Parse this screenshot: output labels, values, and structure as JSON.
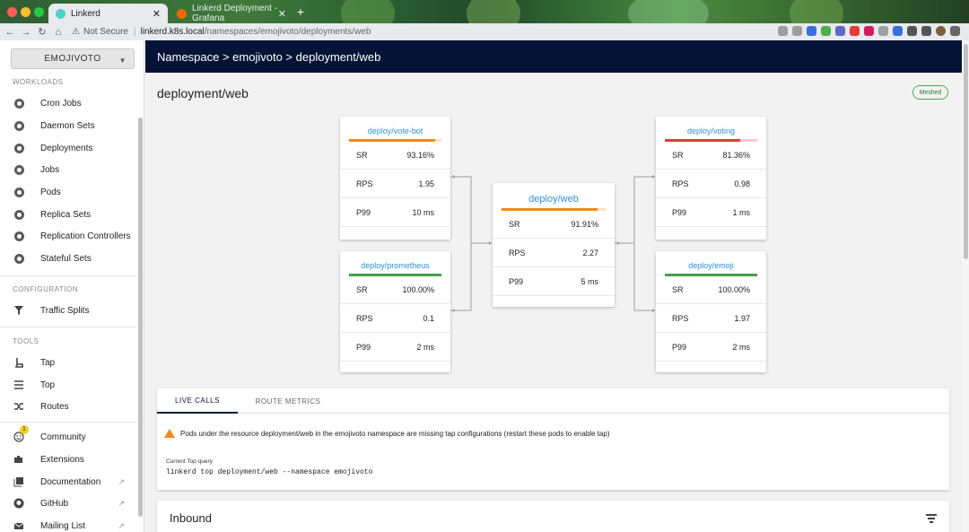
{
  "browser": {
    "tabs": [
      {
        "title": "Linkerd",
        "active": true,
        "favicon_color": "#4fd1c5"
      },
      {
        "title": "Linkerd Deployment - Grafana",
        "active": false,
        "favicon_color": "#f46800"
      }
    ],
    "new_tab": "+",
    "close_glyph": "✕",
    "security": "Not Secure",
    "url_host": "linkerd.k8s.local",
    "url_path": "/namespaces/emojivoto/deployments/web"
  },
  "sidebar": {
    "namespace_select": "EMOJIVOTO",
    "sections": {
      "workloads": "WORKLOADS",
      "configuration": "CONFIGURATION",
      "tools": "TOOLS"
    },
    "workloads": [
      {
        "label": "Cron Jobs",
        "icon": "cron-jobs-icon"
      },
      {
        "label": "Daemon Sets",
        "icon": "daemon-sets-icon"
      },
      {
        "label": "Deployments",
        "icon": "deployments-icon"
      },
      {
        "label": "Jobs",
        "icon": "jobs-icon"
      },
      {
        "label": "Pods",
        "icon": "pods-icon"
      },
      {
        "label": "Replica Sets",
        "icon": "replica-sets-icon"
      },
      {
        "label": "Replication Controllers",
        "icon": "replication-controllers-icon"
      },
      {
        "label": "Stateful Sets",
        "icon": "stateful-sets-icon"
      }
    ],
    "configuration": [
      {
        "label": "Traffic Splits",
        "icon": "filter-icon"
      }
    ],
    "tools": [
      {
        "label": "Tap",
        "icon": "tap-icon"
      },
      {
        "label": "Top",
        "icon": "list-icon"
      },
      {
        "label": "Routes",
        "icon": "shuffle-icon"
      }
    ],
    "community": {
      "label": "Community",
      "badge": "1"
    },
    "links": [
      {
        "label": "Extensions"
      },
      {
        "label": "Documentation"
      },
      {
        "label": "GitHub"
      },
      {
        "label": "Mailing List"
      }
    ]
  },
  "header": {
    "breadcrumb": "Namespace > emojivoto > deployment/web"
  },
  "page": {
    "title": "deployment/web",
    "status_badge": "Meshed"
  },
  "graph": {
    "labels": {
      "sr": "SR",
      "rps": "RPS",
      "p99": "P99"
    },
    "center": {
      "name": "deploy/web",
      "sr": "91.91%",
      "rps": "2.27",
      "p99": "5 ms",
      "success": 0.9191,
      "color": "#ef8a1c"
    },
    "upstream": [
      {
        "name": "deploy/vote-bot",
        "sr": "93.16%",
        "rps": "1.95",
        "p99": "10 ms",
        "success": 0.9316,
        "color": "#ef8a1c"
      },
      {
        "name": "deploy/prometheus",
        "sr": "100.00%",
        "rps": "0.1",
        "p99": "2 ms",
        "success": 1.0,
        "color": "#43a047"
      }
    ],
    "downstream": [
      {
        "name": "deploy/voting",
        "sr": "81.36%",
        "rps": "0.98",
        "p99": "1 ms",
        "success": 0.8136,
        "color": "#e53935"
      },
      {
        "name": "deploy/emoji",
        "sr": "100.00%",
        "rps": "1.97",
        "p99": "2 ms",
        "success": 1.0,
        "color": "#43a047"
      }
    ]
  },
  "live_tabs": {
    "tabs": [
      "LIVE CALLS",
      "ROUTE METRICS"
    ],
    "warning": "Pods under the resource deployment/web in the emojivoto namespace are missing tap configurations (restart these pods to enable tap)",
    "query_label": "Current Top query",
    "query": "linkerd top deployment/web --namespace emojivoto"
  },
  "inbound": {
    "title": "Inbound"
  }
}
